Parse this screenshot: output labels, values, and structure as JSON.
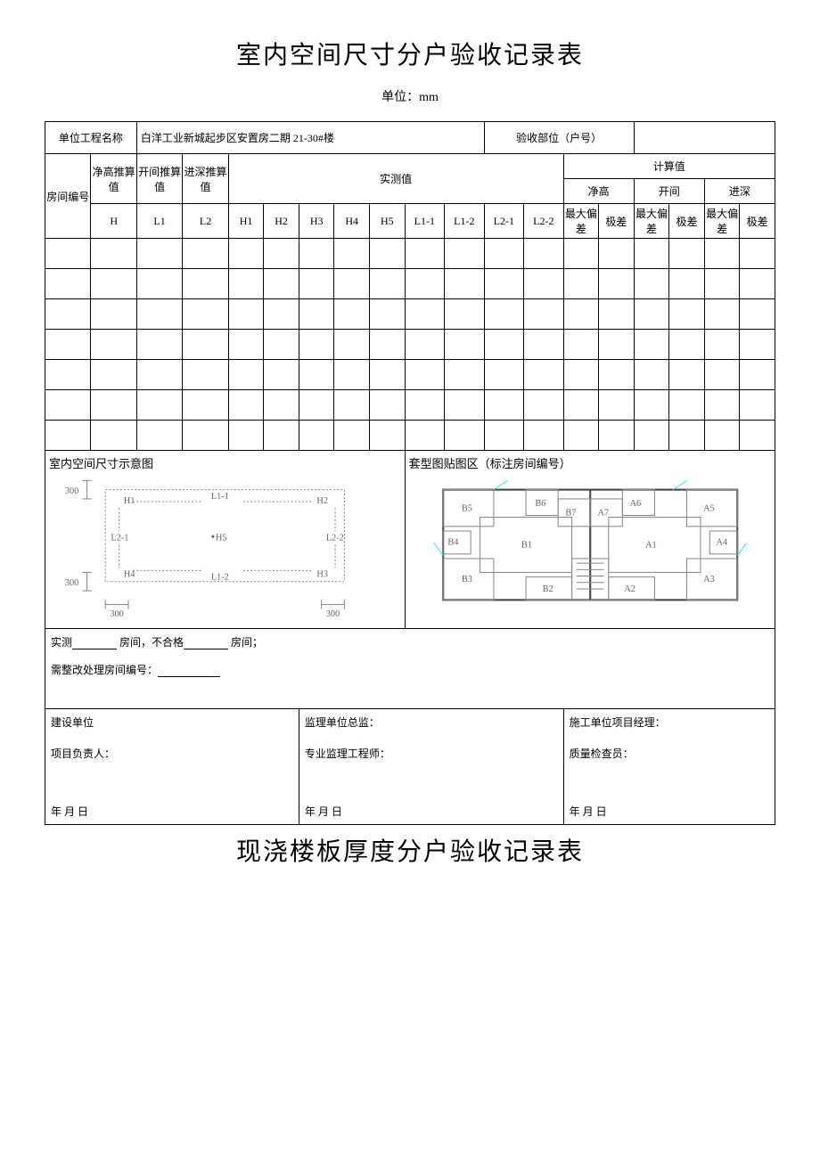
{
  "title": "室内空间尺寸分户验收记录表",
  "unit_label": "单位：mm",
  "header": {
    "project_name_label": "单位工程名称",
    "project_name_value": "白洋工业新城起步区安置房二期 21-30#楼",
    "inspect_part_label": "验收部位（户号）",
    "inspect_part_value": ""
  },
  "columns": {
    "room_no": "房间编号",
    "net_h_design": "净高推算值",
    "span_design": "开间推算值",
    "depth_design": "进深推算值",
    "measured": "实测值",
    "calc": "计算值",
    "H": "H",
    "L1": "L1",
    "L2": "L2",
    "H1": "H1",
    "H2": "H2",
    "H3": "H3",
    "H4": "H4",
    "H5": "H5",
    "L1_1": "L1-1",
    "L1_2": "L1-2",
    "L2_1": "L2-1",
    "L2_2": "L2-2",
    "net_h": "净高",
    "span": "开间",
    "depth": "进深",
    "max_dev": "最大偏差",
    "range": "极差"
  },
  "diagram_left_label": "室内空间尺寸示意图",
  "diagram_right_label": "套型图贴图区（标注房间编号）",
  "diag": {
    "d300": "300",
    "H1": "H1",
    "H2": "H2",
    "H3": "H3",
    "H4": "H4",
    "H5": "H5",
    "L1_1": "L1-1",
    "L1_2": "L1-2",
    "L2_1": "L2-1",
    "L2_2": "L2-2"
  },
  "floorplan_rooms": [
    "B5",
    "B6",
    "B7",
    "A7",
    "A6",
    "A5",
    "B4",
    "B1",
    "A1",
    "A4",
    "B3",
    "A3",
    "B2",
    "A2"
  ],
  "summary": {
    "line1_a": "实测",
    "line1_b": "房间，不合格",
    "line1_c": "房间；",
    "line2_a": "需整改处理房间编号：",
    "line2_b": ""
  },
  "signatures": {
    "col1_a": "建设单位",
    "col1_b": "项目负责人：",
    "col2_a": "监理单位总监：",
    "col2_b": "专业监理工程师：",
    "col3_a": "施工单位项目经理：",
    "col3_b": "质量检查员：",
    "date": "年 月 日"
  },
  "title2": "现浇楼板厚度分户验收记录表"
}
